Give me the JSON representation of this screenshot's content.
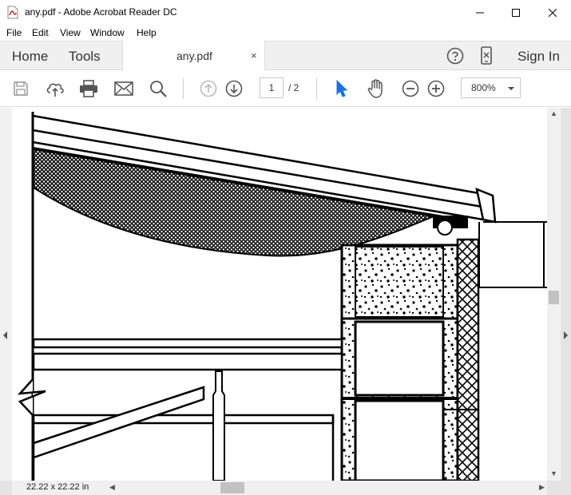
{
  "window": {
    "title": "any.pdf - Adobe Acrobat Reader DC",
    "icon": "pdf-file-icon",
    "controls": [
      "minimize-icon",
      "maximize-icon",
      "close-icon"
    ]
  },
  "menu": {
    "items": [
      "File",
      "Edit",
      "View",
      "Window",
      "Help"
    ]
  },
  "tabs": {
    "home": "Home",
    "tools": "Tools",
    "document": "any.pdf",
    "close": "×",
    "sign_in": "Sign In"
  },
  "toolbar": {
    "icons": [
      "save-icon",
      "cloud-upload-icon",
      "print-icon",
      "mail-icon",
      "search-icon",
      "page-up-icon",
      "page-down-icon",
      "select-cursor-icon",
      "hand-icon",
      "zoom-out-icon",
      "zoom-in-icon"
    ],
    "page_current": "1",
    "page_total": "/ 2",
    "zoom": "800%"
  },
  "status": {
    "page_size": "22.22 x 22.22 in"
  },
  "colors": {
    "accent": "#1473e6",
    "chrome": "#f0f0f0",
    "icon": "#555555"
  }
}
